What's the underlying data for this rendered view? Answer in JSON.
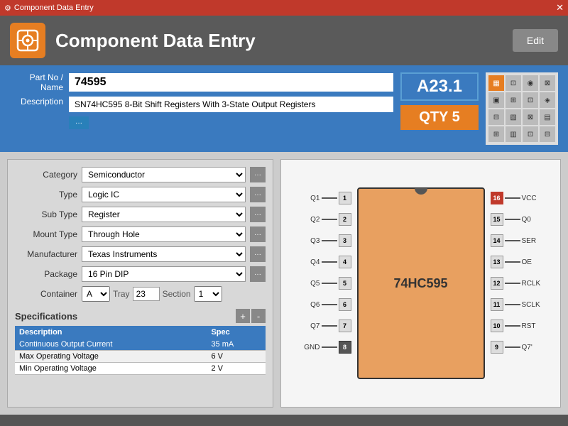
{
  "titlebar": {
    "title": "Component Data Entry",
    "close": "✕"
  },
  "header": {
    "icon": "⚙",
    "title": "Component Data Entry",
    "edit_label": "Edit"
  },
  "form": {
    "part_no_label": "Part No / Name",
    "part_no_value": "74595",
    "desc_label": "Description",
    "desc_value": "SN74HC595 8-Bit Shift Registers With 3-State Output Registers",
    "location_label": "A23.1",
    "qty_label": "QTY 5"
  },
  "properties": {
    "category_label": "Category",
    "category_value": "Semiconductor",
    "type_label": "Type",
    "type_value": "Logic IC",
    "subtype_label": "Sub Type",
    "subtype_value": "Register",
    "mount_label": "Mount Type",
    "mount_value": "Through Hole",
    "mfr_label": "Manufacturer",
    "mfr_value": "Texas Instruments",
    "package_label": "Package",
    "package_value": "16 Pin DIP",
    "container_label": "Container",
    "container_a": "A",
    "container_tray_label": "Tray",
    "container_tray_value": "23",
    "container_section_label": "Section",
    "container_section_value": "1"
  },
  "specs": {
    "title": "Specifications",
    "add_label": "+",
    "remove_label": "-",
    "headers": [
      "Description",
      "Spec"
    ],
    "rows": [
      {
        "desc": "Continuous Output Current",
        "spec": "35 mA",
        "selected": true
      },
      {
        "desc": "Max Operating Voltage",
        "spec": "6 V",
        "selected": false
      },
      {
        "desc": "Min Operating Voltage",
        "spec": "2 V",
        "selected": false
      }
    ]
  },
  "chip": {
    "name": "74HC595",
    "pins_left": [
      {
        "num": "1",
        "label": "Q1",
        "highlight": false
      },
      {
        "num": "2",
        "label": "Q2",
        "highlight": false
      },
      {
        "num": "3",
        "label": "Q3",
        "highlight": false
      },
      {
        "num": "4",
        "label": "Q4",
        "highlight": false
      },
      {
        "num": "5",
        "label": "Q5",
        "highlight": false
      },
      {
        "num": "6",
        "label": "Q6",
        "highlight": false
      },
      {
        "num": "7",
        "label": "Q7",
        "highlight": false
      },
      {
        "num": "8",
        "label": "GND",
        "highlight": true,
        "dark": true
      }
    ],
    "pins_right": [
      {
        "num": "16",
        "label": "VCC",
        "highlight": true
      },
      {
        "num": "15",
        "label": "Q0",
        "highlight": false
      },
      {
        "num": "14",
        "label": "SER",
        "highlight": false
      },
      {
        "num": "13",
        "label": "OE",
        "highlight": false
      },
      {
        "num": "12",
        "label": "RCLK",
        "highlight": false
      },
      {
        "num": "11",
        "label": "SCLK",
        "highlight": false
      },
      {
        "num": "10",
        "label": "RST",
        "highlight": false
      },
      {
        "num": "9",
        "label": "Q7'",
        "highlight": false
      }
    ]
  },
  "icons": [
    "▦",
    "⊡",
    "◉",
    "⊠",
    "▣",
    "⊞",
    "⊡",
    "◈",
    "⊟",
    "▧",
    "⊠",
    "▤",
    "⊞",
    "▥",
    "⊡",
    "⊟"
  ]
}
